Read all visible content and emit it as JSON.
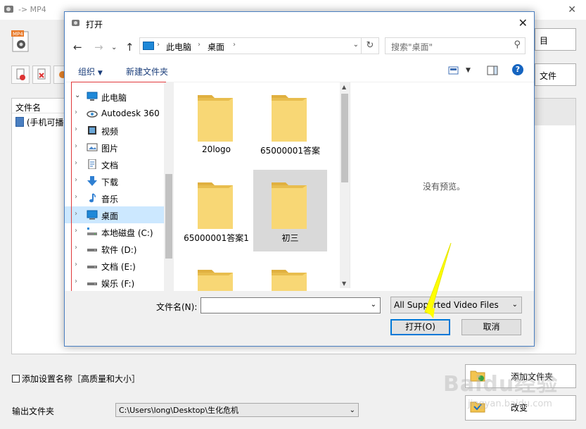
{
  "app": {
    "title": "-> MP4",
    "mp4_label": "MP4"
  },
  "background": {
    "right_buttons": [
      "目",
      "文件"
    ],
    "list": {
      "header": "文件名",
      "row": "(手机可播"
    },
    "option_label": "添加设置名称［高质量和大小］",
    "output_label": "输出文件夹",
    "output_path": "C:\\Users\\long\\Desktop\\生化危机",
    "add_folder_label": "添加文件夹",
    "change_label": "改变"
  },
  "dialog": {
    "title": "打开",
    "breadcrumb": [
      "此电脑",
      "桌面"
    ],
    "search_placeholder": "搜索\"桌面\"",
    "organize_label": "组织",
    "new_folder_label": "新建文件夹",
    "tree": [
      {
        "label": "此电脑",
        "icon": "computer-icon",
        "expanded": true
      },
      {
        "label": "Autodesk 360",
        "icon": "cloud-icon"
      },
      {
        "label": "视频",
        "icon": "video-icon"
      },
      {
        "label": "图片",
        "icon": "picture-icon"
      },
      {
        "label": "文档",
        "icon": "document-icon"
      },
      {
        "label": "下载",
        "icon": "download-icon"
      },
      {
        "label": "音乐",
        "icon": "music-icon"
      },
      {
        "label": "桌面",
        "icon": "desktop-icon",
        "selected": true
      },
      {
        "label": "本地磁盘 (C:)",
        "icon": "drive-c-icon"
      },
      {
        "label": "软件 (D:)",
        "icon": "drive-icon"
      },
      {
        "label": "文档 (E:)",
        "icon": "drive-icon"
      },
      {
        "label": "娱乐 (F:)",
        "icon": "drive-icon"
      }
    ],
    "files": [
      {
        "name": "20logo"
      },
      {
        "name": "65000001答案"
      },
      {
        "name": "65000001答案1"
      },
      {
        "name": "初三",
        "selected": true
      },
      {
        "name": ""
      },
      {
        "name": ""
      }
    ],
    "preview_text": "没有预览。",
    "filename_label": "文件名(N):",
    "filename_value": "",
    "file_type": "All Supported Video Files",
    "open_button": "打开(O)",
    "cancel_button": "取消"
  },
  "watermark": {
    "text": "Baidu经验",
    "sub": "jingyan.baidu.com"
  },
  "colors": {
    "accent": "#0078d7",
    "folder": "#f8d775",
    "highlight": "#e0383a",
    "annotation_arrow": "#ffff00"
  }
}
